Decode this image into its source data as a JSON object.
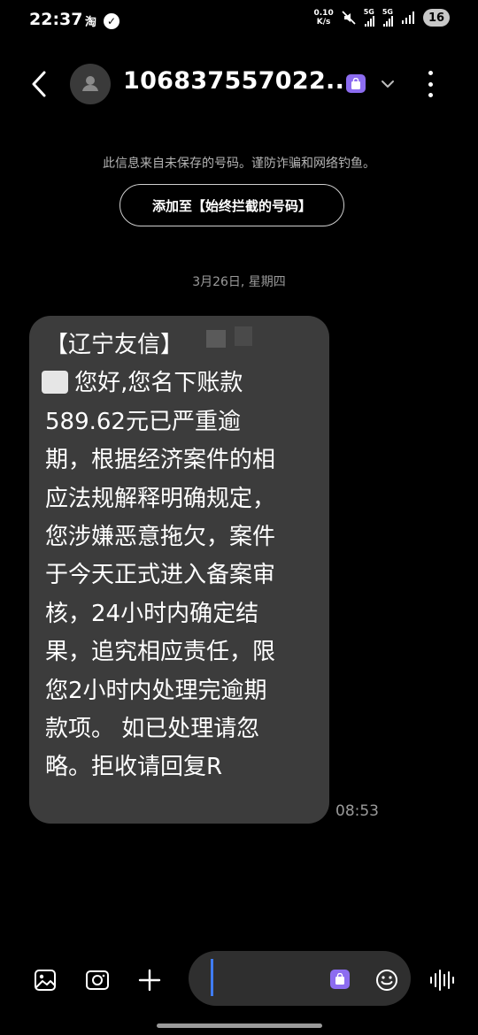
{
  "status_bar": {
    "time": "22:37",
    "taobao_icon_text": "淘",
    "speed_value": "0.10",
    "speed_unit": "K/s",
    "sim1_label": "5G",
    "sim2_label": "5G",
    "battery_level": "16"
  },
  "header": {
    "contact_number": "106837557022...",
    "accent_color": "#8c6cf0"
  },
  "notice": {
    "text": "此信息来自未保存的号码。谨防诈骗和网络钓鱼。",
    "add_button_label": "添加至【始终拦截的号码】"
  },
  "conversation": {
    "date": "3月26日, 星期四",
    "message": {
      "text": "【辽宁友信】\n    您好,您名下账款\n589.62元已严重逾\n期，根据经济案件的相\n应法规解释明确规定，\n您涉嫌恶意拖欠，案件\n于今天正式进入备案审\n核，24小时内确定结\n果，追究相应责任，限\n您2小时内处理完逾期\n款项。 如已处理请忽\n略。拒收请回复R",
      "time": "08:53"
    }
  },
  "composer": {
    "cursor_color": "#3f7cf6",
    "icons": [
      "gallery-icon",
      "camera-icon",
      "plus-icon",
      "shopping-bag-icon",
      "emoji-icon",
      "voice-wave-icon"
    ]
  }
}
